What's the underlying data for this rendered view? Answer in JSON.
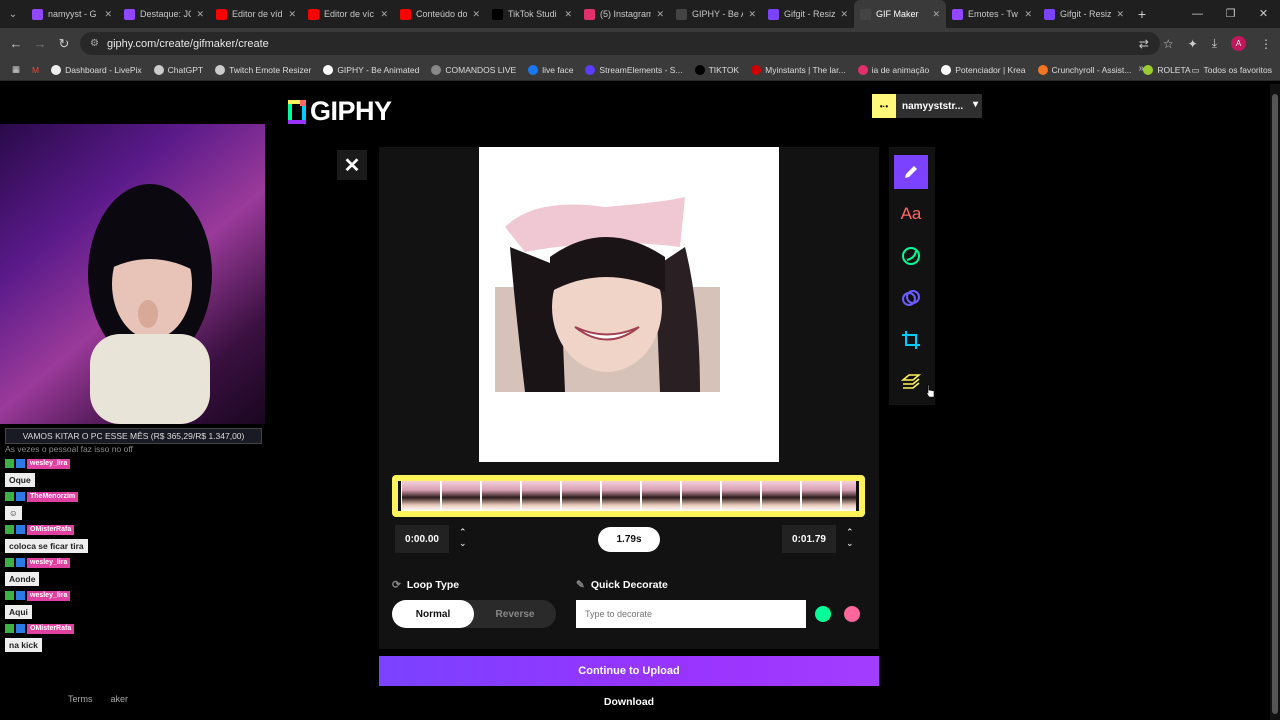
{
  "browser": {
    "tabs": [
      {
        "title": "namyyst - G",
        "color": "#9146ff",
        "active": false
      },
      {
        "title": "Destaque: JC",
        "color": "#9146ff",
        "active": false
      },
      {
        "title": "Editor de víd",
        "color": "#ff0000",
        "active": false
      },
      {
        "title": "Editor de víc",
        "color": "#ff0000",
        "active": false
      },
      {
        "title": "Conteúdo do",
        "color": "#ff0000",
        "active": false
      },
      {
        "title": "TikTok Studi",
        "color": "#000000",
        "active": false
      },
      {
        "title": "(5) Instagram",
        "color": "#e1306c",
        "active": false
      },
      {
        "title": "GIPHY - Be A",
        "color": "#444444",
        "active": false
      },
      {
        "title": "Gifgit - Resiz",
        "color": "#7b42ff",
        "active": false
      },
      {
        "title": "GIF Maker",
        "color": "#444444",
        "active": true
      },
      {
        "title": "Emotes - Tw",
        "color": "#9146ff",
        "active": false
      },
      {
        "title": "Gifgit - Resiz",
        "color": "#7b42ff",
        "active": false
      }
    ],
    "url": "giphy.com/create/gifmaker/create",
    "profile_initial": "A",
    "bookmarks": [
      {
        "label": "Dashboard - LivePix",
        "color": "#eeeeee"
      },
      {
        "label": "ChatGPT",
        "color": "#cccccc"
      },
      {
        "label": "Twitch Emote Resizer",
        "color": "#cccccc"
      },
      {
        "label": "GIPHY - Be Animated",
        "color": "#ffffff"
      },
      {
        "label": "COMANDOS LIVE",
        "color": "#888888"
      },
      {
        "label": "live face",
        "color": "#1877f2"
      },
      {
        "label": "StreamElements - S...",
        "color": "#5c3bff"
      },
      {
        "label": "TIKTOK",
        "color": "#000000"
      },
      {
        "label": "Myinstants | The lar...",
        "color": "#cc0000"
      },
      {
        "label": "ia de animação",
        "color": "#e1306c"
      },
      {
        "label": "Potenciador | Krea",
        "color": "#ffffff"
      },
      {
        "label": "Crunchyroll - Assist...",
        "color": "#f47521"
      },
      {
        "label": "ROLETA",
        "color": "#9acd32"
      }
    ],
    "all_bookmarks_label": "Todos os favoritos"
  },
  "header": {
    "logo_text": "GIPHY",
    "username": "namyyststr..."
  },
  "stream_overlay": {
    "banner": "VAMOS KITAR O PC ESSE MÊS (R$ 365,29/R$ 1.347,00)",
    "faded_line": "As vezes o pessoal faz isso no off",
    "messages": [
      {
        "user": "wesley_lira",
        "text": "Oque"
      },
      {
        "user": "TheMenorzim",
        "text": ""
      },
      {
        "user": "OMisterRafa",
        "text": "coloca se ficar tira"
      },
      {
        "user": "wesley_lira",
        "text": "Aonde"
      },
      {
        "user": "wesley_lira",
        "text": "Aqui"
      },
      {
        "user": "OMisterRafa",
        "text": "na kick"
      }
    ]
  },
  "editor": {
    "start_time": "0:00.00",
    "duration": "1.79s",
    "end_time": "0:01.79",
    "loop_type_label": "Loop Type",
    "loop_options": [
      "Normal",
      "Reverse"
    ],
    "loop_selected": "Normal",
    "quick_decorate_label": "Quick Decorate",
    "decorate_placeholder": "Type to decorate",
    "continue_label": "Continue to Upload",
    "download_label": "Download",
    "frame_count": 12
  },
  "toolbar_tools": [
    "pencil-icon",
    "text-icon",
    "sticker-icon",
    "filter-icon",
    "crop-icon",
    "layers-icon"
  ],
  "footer": {
    "terms_label": "Terms",
    "maker_label": "aker"
  },
  "colors": {
    "accent": "#7b42ff",
    "timeline": "#fff35c",
    "text_tool": "#ff6666",
    "sticker_tool": "#00ff99"
  }
}
